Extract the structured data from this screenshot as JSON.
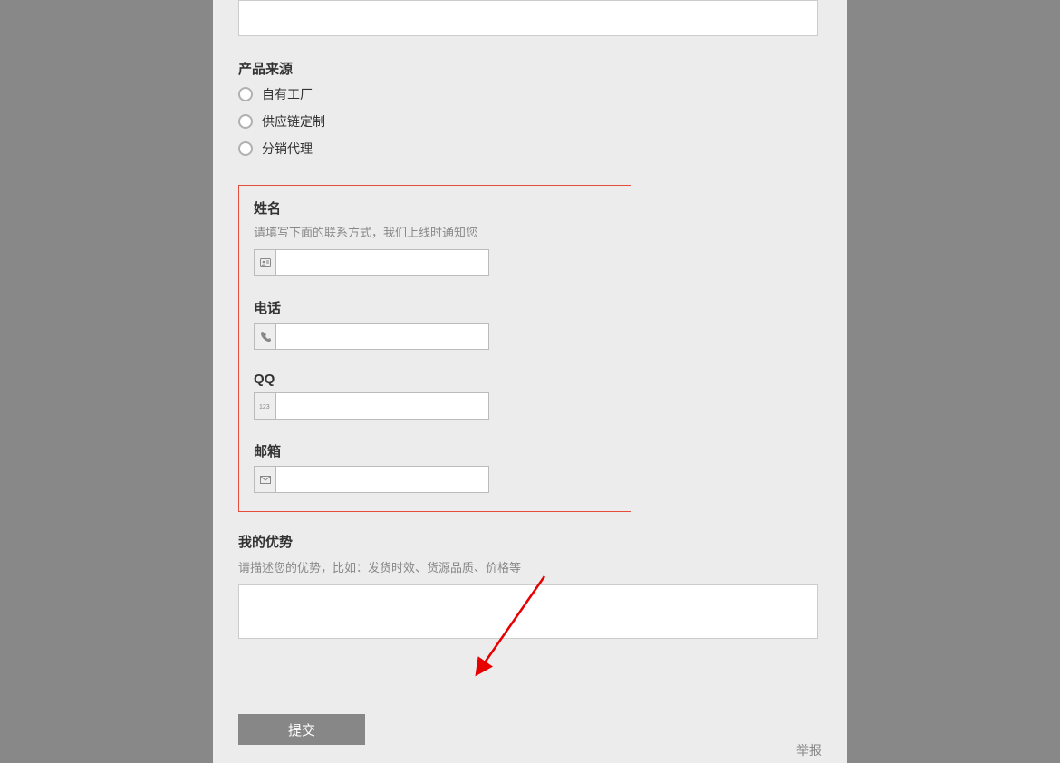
{
  "product_source": {
    "label": "产品来源",
    "options": [
      "自有工厂",
      "供应链定制",
      "分销代理"
    ]
  },
  "contact": {
    "name_label": "姓名",
    "contact_hint": "请填写下面的联系方式，我们上线时通知您",
    "phone_label": "电话",
    "qq_label": "QQ",
    "email_label": "邮箱"
  },
  "advantage": {
    "label": "我的优势",
    "hint": "请描述您的优势，比如：发货时效、货源品质、价格等"
  },
  "submit_label": "提交",
  "report_label": "举报"
}
